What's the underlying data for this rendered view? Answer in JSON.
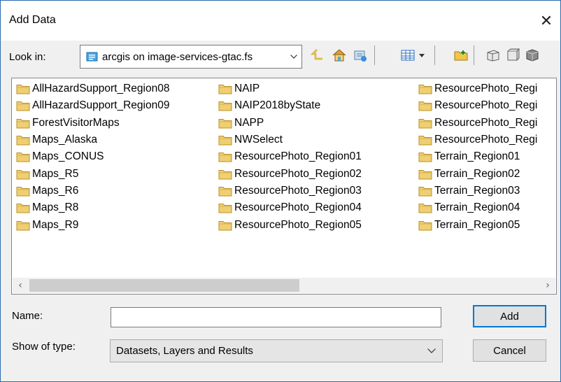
{
  "window": {
    "title": "Add Data",
    "close_glyph": "✕"
  },
  "toolbar": {
    "lookin_label": "Look in:",
    "lookin_value": "arcgis on image-services-gtac.fs",
    "icons": [
      "up-one-level-icon",
      "home-icon",
      "connect-folder-icon",
      "view-options-icon",
      "new-folder-icon",
      "catalog-icon",
      "new-feature-class-icon",
      "new-database-icon"
    ]
  },
  "files": {
    "col1": [
      "AllHazardSupport_Region08",
      "AllHazardSupport_Region09",
      "ForestVisitorMaps",
      "Maps_Alaska",
      "Maps_CONUS",
      "Maps_R5",
      "Maps_R6",
      "Maps_R8",
      "Maps_R9"
    ],
    "col2": [
      "NAIP",
      "NAIP2018byState",
      "NAPP",
      "NWSelect",
      "ResourcePhoto_Region01",
      "ResourcePhoto_Region02",
      "ResourcePhoto_Region03",
      "ResourcePhoto_Region04",
      "ResourcePhoto_Region05"
    ],
    "col3": [
      "ResourcePhoto_Regi",
      "ResourcePhoto_Regi",
      "ResourcePhoto_Regi",
      "ResourcePhoto_Regi",
      "Terrain_Region01",
      "Terrain_Region02",
      "Terrain_Region03",
      "Terrain_Region04",
      "Terrain_Region05"
    ]
  },
  "form": {
    "name_label": "Name:",
    "name_value": "",
    "type_label": "Show of type:",
    "type_value": "Datasets, Layers and Results"
  },
  "buttons": {
    "add": "Add",
    "cancel": "Cancel"
  },
  "colors": {
    "accent": "#0078d7",
    "folder": "#e8c26a"
  }
}
